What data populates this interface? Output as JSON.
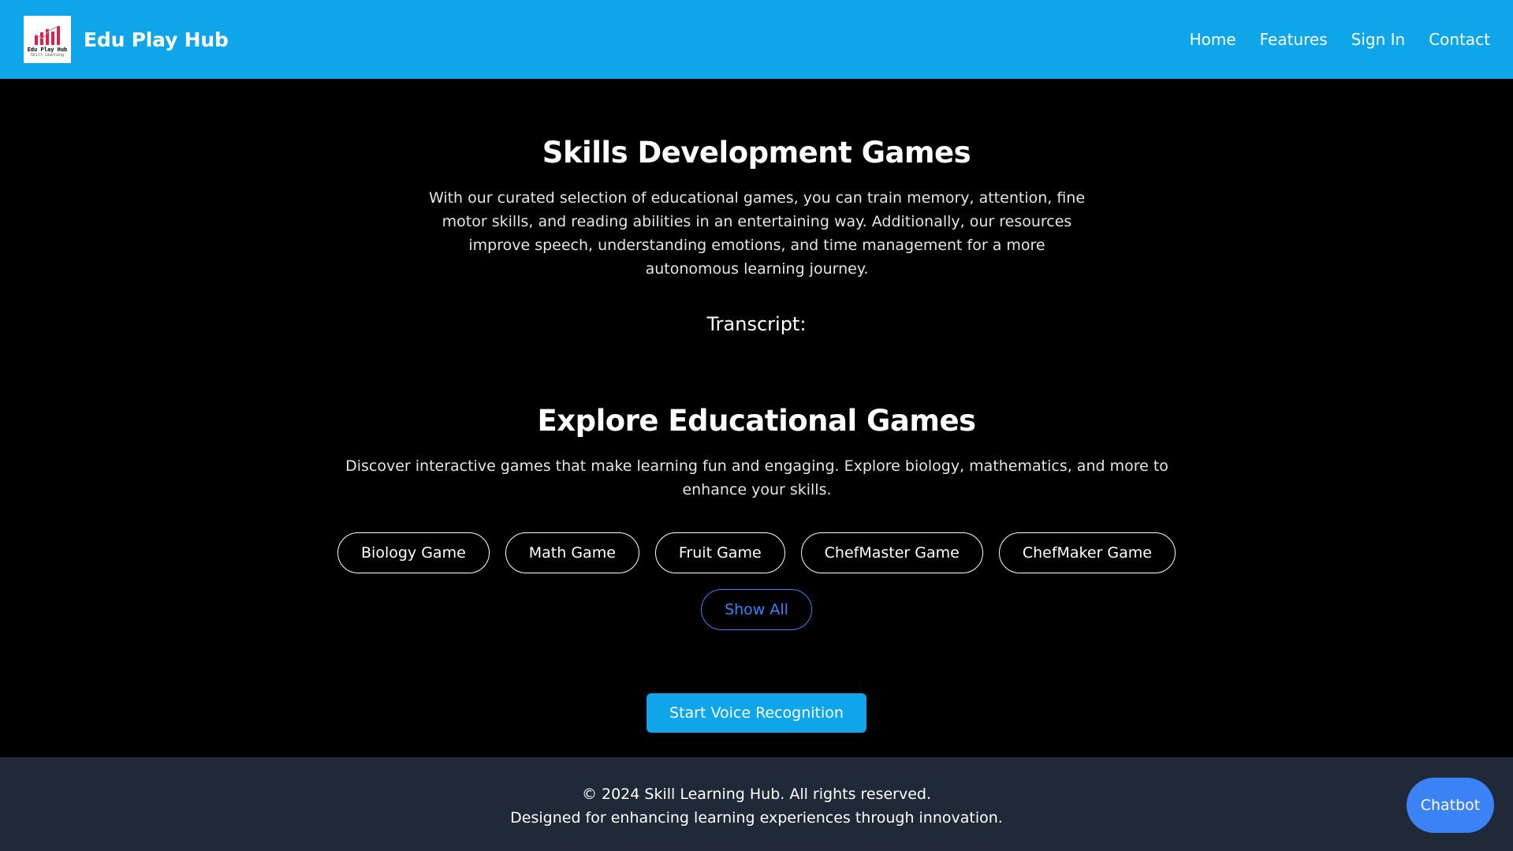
{
  "navbar": {
    "brand": "Edu Play Hub",
    "logo_text": "Edu Play Hub",
    "logo_subtext": "Skill Learning",
    "links": [
      {
        "label": "Home"
      },
      {
        "label": "Features"
      },
      {
        "label": "Sign In"
      },
      {
        "label": "Contact"
      }
    ]
  },
  "skills": {
    "title": "Skills Development Games",
    "description": "With our curated selection of educational games, you can train memory, attention, fine motor skills, and reading abilities in an entertaining way. Additionally, our resources improve speech, understanding emotions, and time management for a more autonomous learning journey."
  },
  "transcript": {
    "label": "Transcript:"
  },
  "explore": {
    "title": "Explore Educational Games",
    "description": "Discover interactive games that make learning fun and engaging. Explore biology, mathematics, and more to enhance your skills.",
    "games": [
      {
        "label": "Biology Game"
      },
      {
        "label": "Math Game"
      },
      {
        "label": "Fruit Game"
      },
      {
        "label": "ChefMaster Game"
      },
      {
        "label": "ChefMaker Game"
      }
    ],
    "show_all_label": "Show All"
  },
  "voice": {
    "button_label": "Start Voice Recognition"
  },
  "footer": {
    "line1": "© 2024 Skill Learning Hub. All rights reserved.",
    "line2": "Designed for enhancing learning experiences through innovation."
  },
  "chatbot": {
    "label": "Chatbot"
  },
  "colors": {
    "navbar_bg": "#0ea5e9",
    "page_bg": "#000000",
    "footer_bg": "#1f2937",
    "accent_blue": "#3b82f6",
    "logo_bar_red": "#e11d48"
  }
}
